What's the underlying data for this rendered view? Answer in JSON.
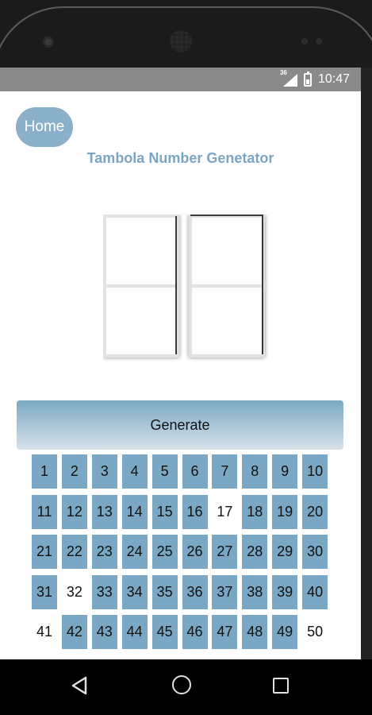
{
  "status_bar": {
    "time": "10:47",
    "network": "36"
  },
  "app": {
    "home_label": "Home",
    "title": "Tambola Number Genetator",
    "generate_label": "Generate",
    "accent_color": "#7aa8c4"
  },
  "board": {
    "rows": [
      [
        {
          "n": "1",
          "drawn": false
        },
        {
          "n": "2",
          "drawn": false
        },
        {
          "n": "3",
          "drawn": false
        },
        {
          "n": "4",
          "drawn": false
        },
        {
          "n": "5",
          "drawn": false
        },
        {
          "n": "6",
          "drawn": false
        },
        {
          "n": "7",
          "drawn": false
        },
        {
          "n": "8",
          "drawn": false
        },
        {
          "n": "9",
          "drawn": false
        },
        {
          "n": "10",
          "drawn": false
        }
      ],
      [
        {
          "n": "11",
          "drawn": false
        },
        {
          "n": "12",
          "drawn": false
        },
        {
          "n": "13",
          "drawn": false
        },
        {
          "n": "14",
          "drawn": false
        },
        {
          "n": "15",
          "drawn": false
        },
        {
          "n": "16",
          "drawn": false
        },
        {
          "n": "17",
          "drawn": true
        },
        {
          "n": "18",
          "drawn": false
        },
        {
          "n": "19",
          "drawn": false
        },
        {
          "n": "20",
          "drawn": false
        }
      ],
      [
        {
          "n": "21",
          "drawn": false
        },
        {
          "n": "22",
          "drawn": false
        },
        {
          "n": "23",
          "drawn": false
        },
        {
          "n": "24",
          "drawn": false
        },
        {
          "n": "25",
          "drawn": false
        },
        {
          "n": "26",
          "drawn": false
        },
        {
          "n": "27",
          "drawn": false
        },
        {
          "n": "28",
          "drawn": false
        },
        {
          "n": "29",
          "drawn": false
        },
        {
          "n": "30",
          "drawn": false
        }
      ],
      [
        {
          "n": "31",
          "drawn": false
        },
        {
          "n": "32",
          "drawn": true
        },
        {
          "n": "33",
          "drawn": false
        },
        {
          "n": "34",
          "drawn": false
        },
        {
          "n": "35",
          "drawn": false
        },
        {
          "n": "36",
          "drawn": false
        },
        {
          "n": "37",
          "drawn": false
        },
        {
          "n": "38",
          "drawn": false
        },
        {
          "n": "39",
          "drawn": false
        },
        {
          "n": "40",
          "drawn": false
        }
      ],
      [
        {
          "n": "41",
          "drawn": true
        },
        {
          "n": "42",
          "drawn": false
        },
        {
          "n": "43",
          "drawn": false
        },
        {
          "n": "44",
          "drawn": false
        },
        {
          "n": "45",
          "drawn": false
        },
        {
          "n": "46",
          "drawn": false
        },
        {
          "n": "47",
          "drawn": false
        },
        {
          "n": "48",
          "drawn": false
        },
        {
          "n": "49",
          "drawn": false
        },
        {
          "n": "50",
          "drawn": true
        }
      ]
    ]
  },
  "icons": {
    "back": "back-triangle-icon",
    "home": "home-circle-icon",
    "recents": "recents-square-icon"
  }
}
